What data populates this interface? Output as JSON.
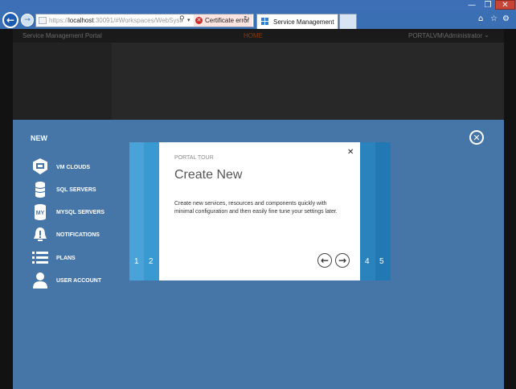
{
  "window": {
    "min_glyph": "—",
    "max_glyph": "❐",
    "close_glyph": "✕"
  },
  "browser": {
    "url_prefix": "https://",
    "url_host": "localhost",
    "url_rest": ":30091/#Workspaces/WebSyst",
    "cert_error": "Certificate error",
    "tab_title": "Service Management",
    "icons": [
      "back-icon",
      "forward-icon",
      "search-icon",
      "refresh-icon",
      "home-icon",
      "favorites-star-icon",
      "gear-icon"
    ]
  },
  "portal": {
    "title": "Service Management Portal",
    "tab": "HOME",
    "user": "PORTALVM\\Administrator"
  },
  "drawer": {
    "title": "NEW",
    "items": [
      {
        "label": "VM CLOUDS",
        "icon": "vm-cloud-icon"
      },
      {
        "label": "SQL SERVERS",
        "icon": "database-icon"
      },
      {
        "label": "MYSQL SERVERS",
        "icon": "mysql-icon"
      },
      {
        "label": "NOTIFICATIONS",
        "icon": "notification-icon"
      },
      {
        "label": "PLANS",
        "icon": "list-icon"
      },
      {
        "label": "USER ACCOUNT",
        "icon": "user-icon"
      }
    ]
  },
  "tour": {
    "kicker": "PORTAL TOUR",
    "title": "Create New",
    "body": "Create new services, resources and components quickly with minimal configuration and then easily fine tune your settings later.",
    "steps_left": [
      "1",
      "2"
    ],
    "steps_right": [
      "4",
      "5"
    ]
  },
  "colors": {
    "drawer_bg": "#4675a8",
    "chrome_blue": "#3b6fb4",
    "tour_light": "#4aa3d8",
    "tour_dark": "#2b83bd"
  }
}
